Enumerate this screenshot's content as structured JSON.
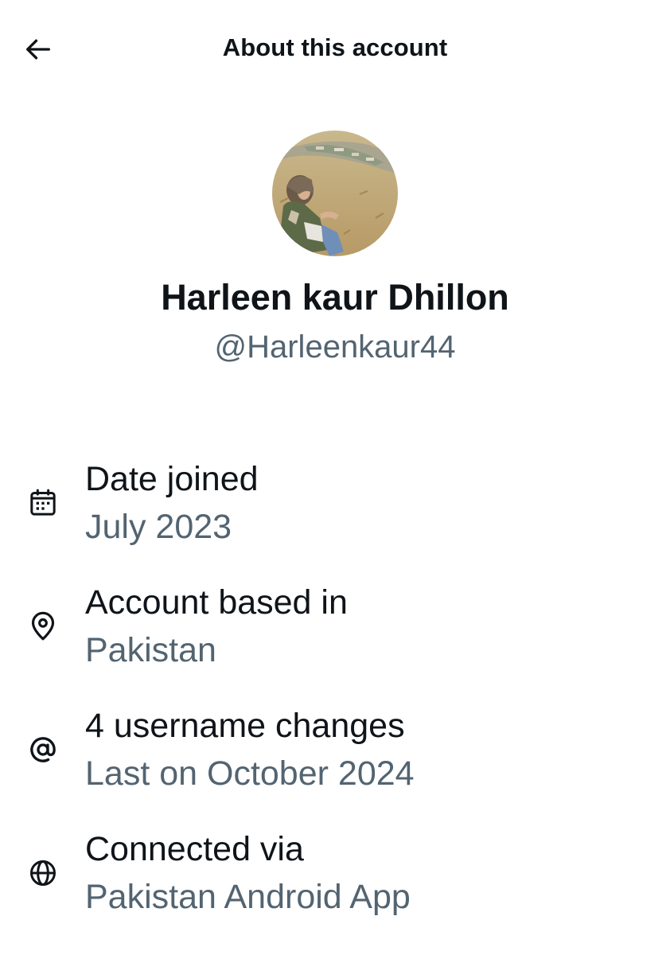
{
  "header": {
    "title": "About this account",
    "back_icon": "arrow-left-icon"
  },
  "profile": {
    "display_name": "Harleen kaur Dhillon",
    "handle": "@Harleenkaur44"
  },
  "info": {
    "date_joined": {
      "icon": "calendar-icon",
      "label": "Date joined",
      "value": "July 2023"
    },
    "account_based_in": {
      "icon": "location-pin-icon",
      "label": "Account based in",
      "value": "Pakistan"
    },
    "username_changes": {
      "icon": "at-sign-icon",
      "label": "4 username changes",
      "value": "Last on October 2024"
    },
    "connected_via": {
      "icon": "globe-icon",
      "label": "Connected via",
      "value": "Pakistan Android App"
    }
  },
  "colors": {
    "primary_text": "#0f1419",
    "secondary_text": "#536471",
    "background": "#ffffff"
  }
}
